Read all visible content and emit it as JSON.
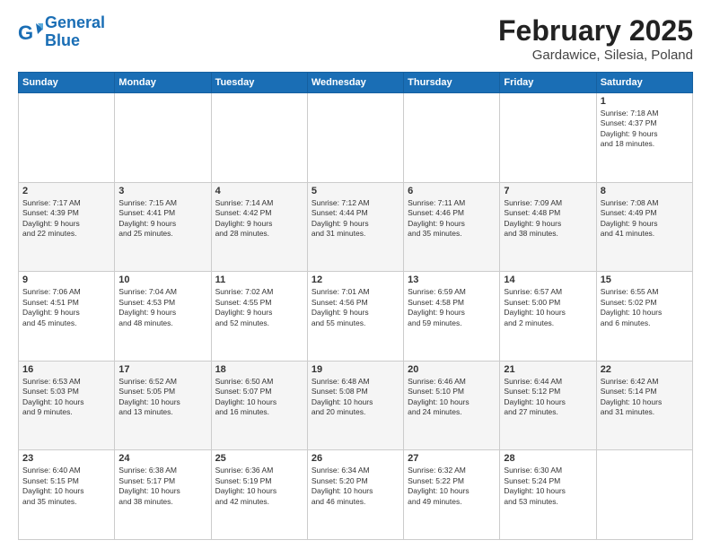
{
  "logo": {
    "line1": "General",
    "line2": "Blue"
  },
  "title": "February 2025",
  "subtitle": "Gardawice, Silesia, Poland",
  "weekdays": [
    "Sunday",
    "Monday",
    "Tuesday",
    "Wednesday",
    "Thursday",
    "Friday",
    "Saturday"
  ],
  "weeks": [
    [
      {
        "day": "",
        "info": ""
      },
      {
        "day": "",
        "info": ""
      },
      {
        "day": "",
        "info": ""
      },
      {
        "day": "",
        "info": ""
      },
      {
        "day": "",
        "info": ""
      },
      {
        "day": "",
        "info": ""
      },
      {
        "day": "1",
        "info": "Sunrise: 7:18 AM\nSunset: 4:37 PM\nDaylight: 9 hours\nand 18 minutes."
      }
    ],
    [
      {
        "day": "2",
        "info": "Sunrise: 7:17 AM\nSunset: 4:39 PM\nDaylight: 9 hours\nand 22 minutes."
      },
      {
        "day": "3",
        "info": "Sunrise: 7:15 AM\nSunset: 4:41 PM\nDaylight: 9 hours\nand 25 minutes."
      },
      {
        "day": "4",
        "info": "Sunrise: 7:14 AM\nSunset: 4:42 PM\nDaylight: 9 hours\nand 28 minutes."
      },
      {
        "day": "5",
        "info": "Sunrise: 7:12 AM\nSunset: 4:44 PM\nDaylight: 9 hours\nand 31 minutes."
      },
      {
        "day": "6",
        "info": "Sunrise: 7:11 AM\nSunset: 4:46 PM\nDaylight: 9 hours\nand 35 minutes."
      },
      {
        "day": "7",
        "info": "Sunrise: 7:09 AM\nSunset: 4:48 PM\nDaylight: 9 hours\nand 38 minutes."
      },
      {
        "day": "8",
        "info": "Sunrise: 7:08 AM\nSunset: 4:49 PM\nDaylight: 9 hours\nand 41 minutes."
      }
    ],
    [
      {
        "day": "9",
        "info": "Sunrise: 7:06 AM\nSunset: 4:51 PM\nDaylight: 9 hours\nand 45 minutes."
      },
      {
        "day": "10",
        "info": "Sunrise: 7:04 AM\nSunset: 4:53 PM\nDaylight: 9 hours\nand 48 minutes."
      },
      {
        "day": "11",
        "info": "Sunrise: 7:02 AM\nSunset: 4:55 PM\nDaylight: 9 hours\nand 52 minutes."
      },
      {
        "day": "12",
        "info": "Sunrise: 7:01 AM\nSunset: 4:56 PM\nDaylight: 9 hours\nand 55 minutes."
      },
      {
        "day": "13",
        "info": "Sunrise: 6:59 AM\nSunset: 4:58 PM\nDaylight: 9 hours\nand 59 minutes."
      },
      {
        "day": "14",
        "info": "Sunrise: 6:57 AM\nSunset: 5:00 PM\nDaylight: 10 hours\nand 2 minutes."
      },
      {
        "day": "15",
        "info": "Sunrise: 6:55 AM\nSunset: 5:02 PM\nDaylight: 10 hours\nand 6 minutes."
      }
    ],
    [
      {
        "day": "16",
        "info": "Sunrise: 6:53 AM\nSunset: 5:03 PM\nDaylight: 10 hours\nand 9 minutes."
      },
      {
        "day": "17",
        "info": "Sunrise: 6:52 AM\nSunset: 5:05 PM\nDaylight: 10 hours\nand 13 minutes."
      },
      {
        "day": "18",
        "info": "Sunrise: 6:50 AM\nSunset: 5:07 PM\nDaylight: 10 hours\nand 16 minutes."
      },
      {
        "day": "19",
        "info": "Sunrise: 6:48 AM\nSunset: 5:08 PM\nDaylight: 10 hours\nand 20 minutes."
      },
      {
        "day": "20",
        "info": "Sunrise: 6:46 AM\nSunset: 5:10 PM\nDaylight: 10 hours\nand 24 minutes."
      },
      {
        "day": "21",
        "info": "Sunrise: 6:44 AM\nSunset: 5:12 PM\nDaylight: 10 hours\nand 27 minutes."
      },
      {
        "day": "22",
        "info": "Sunrise: 6:42 AM\nSunset: 5:14 PM\nDaylight: 10 hours\nand 31 minutes."
      }
    ],
    [
      {
        "day": "23",
        "info": "Sunrise: 6:40 AM\nSunset: 5:15 PM\nDaylight: 10 hours\nand 35 minutes."
      },
      {
        "day": "24",
        "info": "Sunrise: 6:38 AM\nSunset: 5:17 PM\nDaylight: 10 hours\nand 38 minutes."
      },
      {
        "day": "25",
        "info": "Sunrise: 6:36 AM\nSunset: 5:19 PM\nDaylight: 10 hours\nand 42 minutes."
      },
      {
        "day": "26",
        "info": "Sunrise: 6:34 AM\nSunset: 5:20 PM\nDaylight: 10 hours\nand 46 minutes."
      },
      {
        "day": "27",
        "info": "Sunrise: 6:32 AM\nSunset: 5:22 PM\nDaylight: 10 hours\nand 49 minutes."
      },
      {
        "day": "28",
        "info": "Sunrise: 6:30 AM\nSunset: 5:24 PM\nDaylight: 10 hours\nand 53 minutes."
      },
      {
        "day": "",
        "info": ""
      }
    ]
  ]
}
